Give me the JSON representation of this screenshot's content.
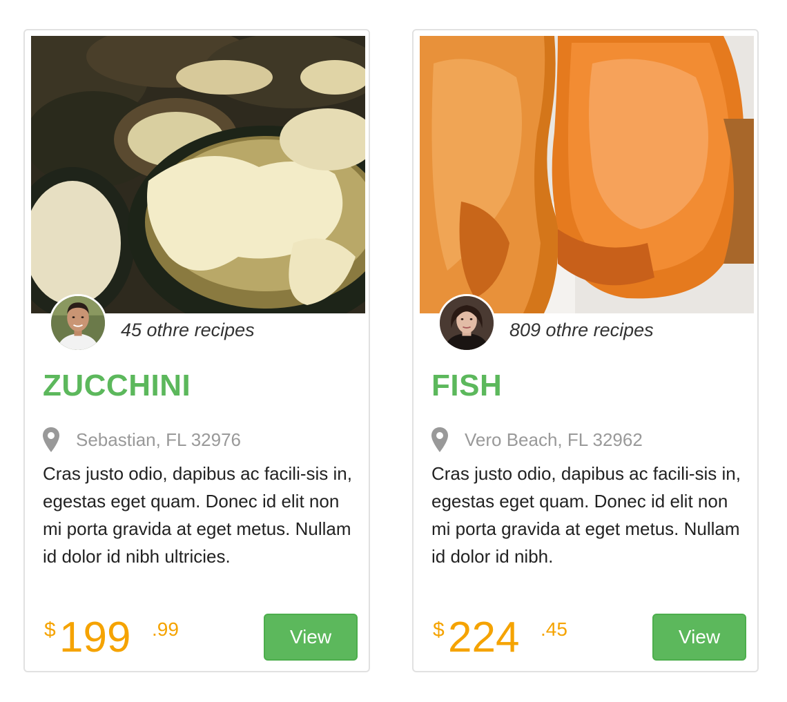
{
  "cards": [
    {
      "author_recipes": "45 othre recipes",
      "title": "ZUCCHINI",
      "location": "Sebastian, FL 32976",
      "description": "Cras justo odio, dapibus ac facili-sis in, egestas eget quam. Donec id elit non mi porta gravida at eget metus. Nullam id dolor id nibh ultricies.",
      "price": {
        "currency": "$",
        "main": "199",
        "cents": ".99"
      },
      "button_label": "View",
      "photo_icon": "zucchini-photo",
      "avatar_icon": "chef-avatar"
    },
    {
      "author_recipes": "809 othre recipes",
      "title": "FISH",
      "location": "Vero Beach, FL 32962",
      "description": "Cras justo odio, dapibus ac facili-sis in, egestas eget quam. Donec id elit non mi porta gravida at eget metus. Nullam id dolor id nibh.",
      "price": {
        "currency": "$",
        "main": "224",
        "cents": ".45"
      },
      "button_label": "View",
      "photo_icon": "fish-photo",
      "avatar_icon": "woman-avatar"
    }
  ],
  "colors": {
    "title": "#5cb85c",
    "price": "#f5a300",
    "button": "#5cb85c",
    "location": "#999999"
  }
}
